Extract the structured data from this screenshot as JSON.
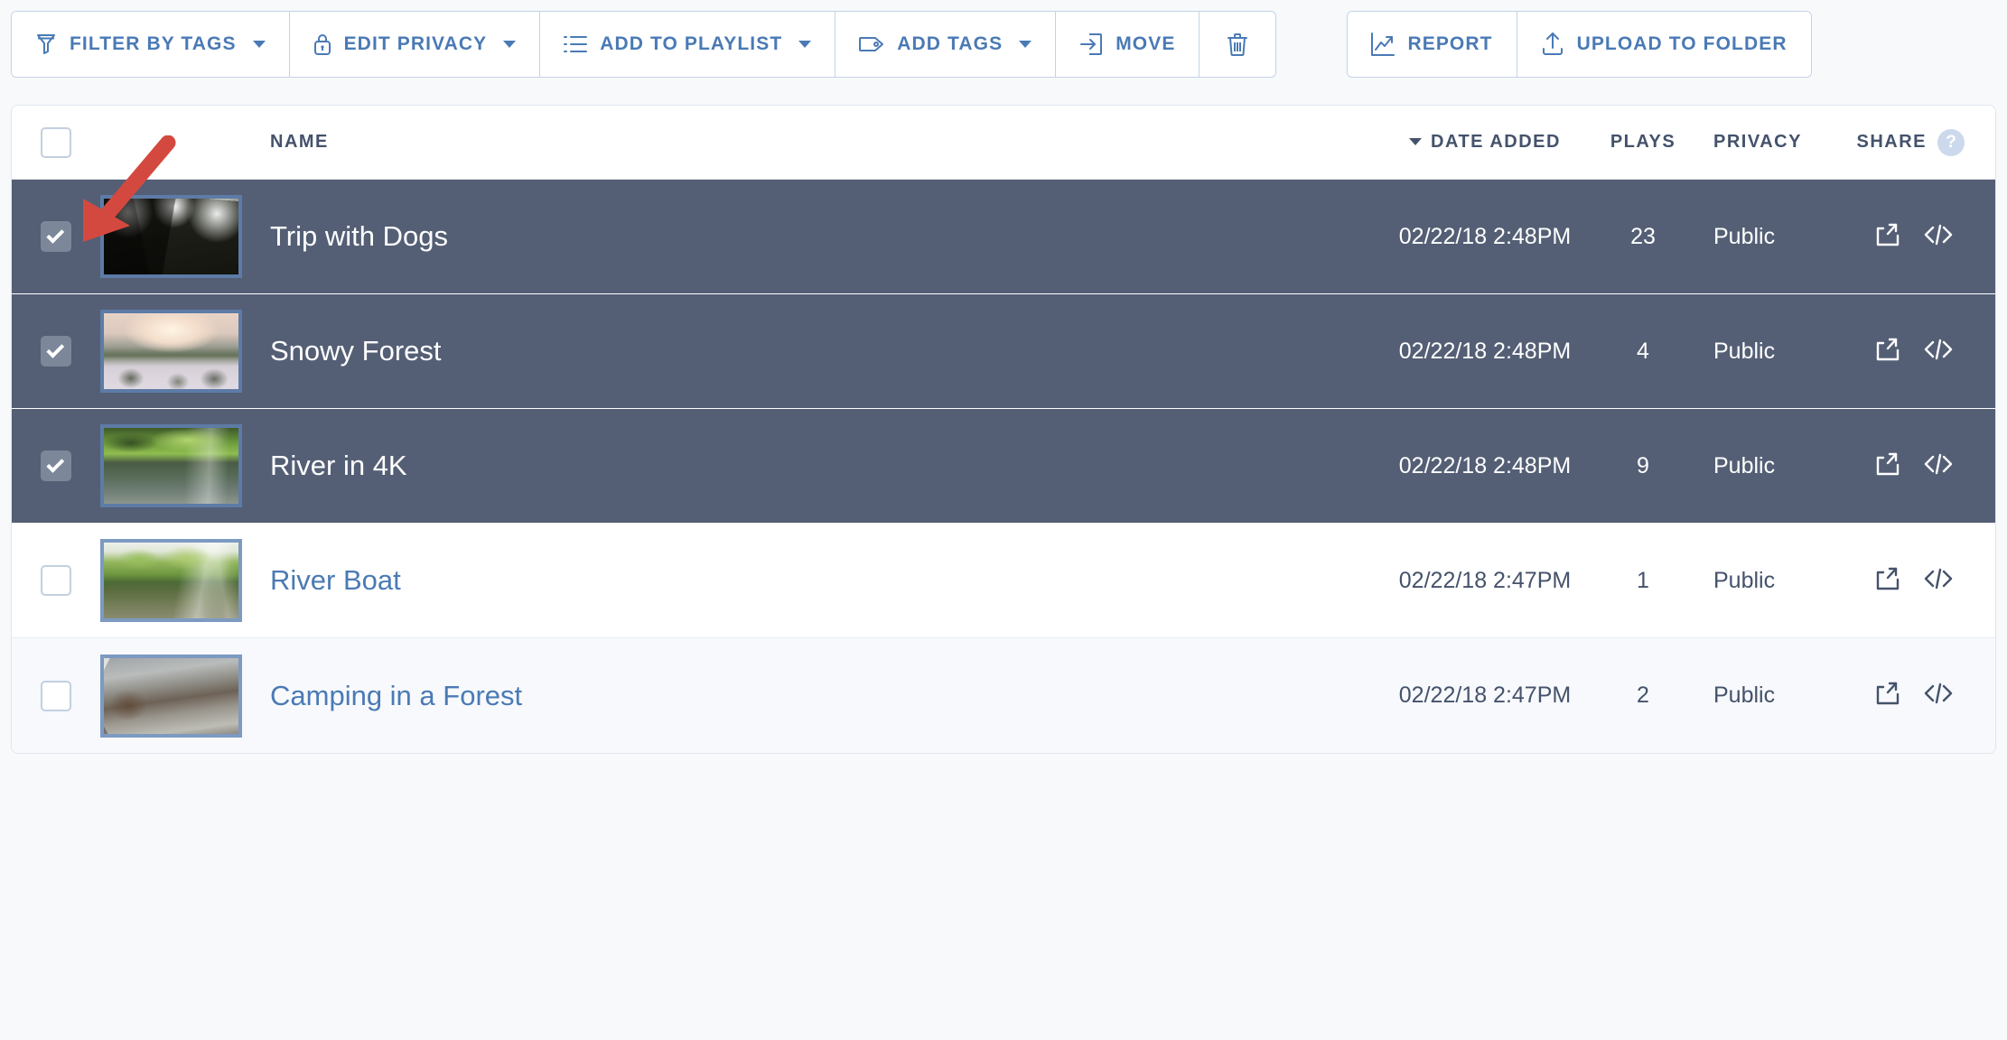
{
  "toolbar": {
    "left_group": [
      {
        "label": "Filter by Tags",
        "icon": "funnel-icon",
        "caret": true
      },
      {
        "label": "Edit Privacy",
        "icon": "lock-icon",
        "caret": true
      },
      {
        "label": "Add to Playlist",
        "icon": "list-icon",
        "caret": true
      },
      {
        "label": "Add Tags",
        "icon": "tag-icon",
        "caret": true
      },
      {
        "label": "Move",
        "icon": "move-icon",
        "caret": false
      },
      {
        "label": "",
        "icon": "trash-icon",
        "caret": false
      }
    ],
    "right_group": [
      {
        "label": "Report",
        "icon": "chart-line-icon",
        "caret": false
      },
      {
        "label": "Upload to Folder",
        "icon": "upload-icon",
        "caret": false
      }
    ]
  },
  "table": {
    "headers": {
      "select_all": "",
      "name": "NAME",
      "date_added": "DATE ADDED",
      "plays": "PLAYS",
      "privacy": "PRIVACY",
      "share": "SHARE",
      "help": "?"
    },
    "sort": {
      "column": "DATE ADDED",
      "direction": "desc",
      "indicator": "▼"
    },
    "rows": [
      {
        "name": "Trip with Dogs",
        "date": "02/22/18 2:48PM",
        "plays": "23",
        "privacy": "Public",
        "selected": true,
        "thumb": "forest-canopy"
      },
      {
        "name": "Snowy Forest",
        "date": "02/22/18 2:48PM",
        "plays": "4",
        "privacy": "Public",
        "selected": true,
        "thumb": "snowy-sunset"
      },
      {
        "name": "River in 4K",
        "date": "02/22/18 2:48PM",
        "plays": "9",
        "privacy": "Public",
        "selected": true,
        "thumb": "river-4k"
      },
      {
        "name": "River Boat",
        "date": "02/22/18 2:47PM",
        "plays": "1",
        "privacy": "Public",
        "selected": false,
        "thumb": "river-boat"
      },
      {
        "name": "Camping in a Forest",
        "date": "02/22/18 2:47PM",
        "plays": "2",
        "privacy": "Public",
        "selected": false,
        "thumb": "camping"
      }
    ]
  },
  "annotation": {
    "type": "arrow",
    "color": "#d4493f",
    "points_to": "row-1-checkbox"
  },
  "colors": {
    "accent_blue": "#4a7ab5",
    "selected_row": "#545f75",
    "header_text": "#44526b",
    "page_bg": "#f7f9fb",
    "annotation_red": "#d4493f"
  }
}
